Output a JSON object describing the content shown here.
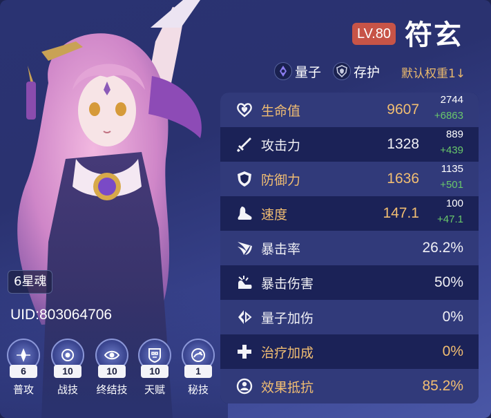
{
  "character": {
    "level": "LV.80",
    "name": "符玄",
    "element": "量子",
    "path": "存护",
    "weight_label": "默认权重1↓",
    "eidolon": "6星魂",
    "uid": "UID:803064706"
  },
  "stats": [
    {
      "name": "生命值",
      "value": "9607",
      "base": "2744",
      "bonus": "+6863",
      "highlight": true,
      "icon": "heart-icon"
    },
    {
      "name": "攻击力",
      "value": "1328",
      "base": "889",
      "bonus": "+439",
      "highlight": false,
      "icon": "sword-icon"
    },
    {
      "name": "防御力",
      "value": "1636",
      "base": "1135",
      "bonus": "+501",
      "highlight": true,
      "icon": "shield-icon"
    },
    {
      "name": "速度",
      "value": "147.1",
      "base": "100",
      "bonus": "+47.1",
      "highlight": true,
      "icon": "boot-icon"
    },
    {
      "name": "暴击率",
      "value": "26.2%",
      "highlight": false,
      "icon": "crit-rate-icon"
    },
    {
      "name": "暴击伤害",
      "value": "50%",
      "highlight": false,
      "icon": "crit-damage-icon"
    },
    {
      "name": "量子加伤",
      "value": "0%",
      "highlight": false,
      "icon": "quantum-damage-icon"
    },
    {
      "name": "治疗加成",
      "value": "0%",
      "highlight": true,
      "icon": "healing-cross-icon"
    },
    {
      "name": "效果抵抗",
      "value": "85.2%",
      "highlight": true,
      "icon": "effect-res-icon"
    }
  ],
  "skills": [
    {
      "name": "普攻",
      "level": "6"
    },
    {
      "name": "战技",
      "level": "10"
    },
    {
      "name": "终结技",
      "level": "10"
    },
    {
      "name": "天赋",
      "level": "10"
    },
    {
      "name": "秘技",
      "level": "1"
    }
  ],
  "colors": {
    "highlight": "#f2be72",
    "bonus": "#69c86a",
    "level_badge": "#c75447",
    "panel": "#1b2257",
    "panel_alt": "#313a7a"
  }
}
